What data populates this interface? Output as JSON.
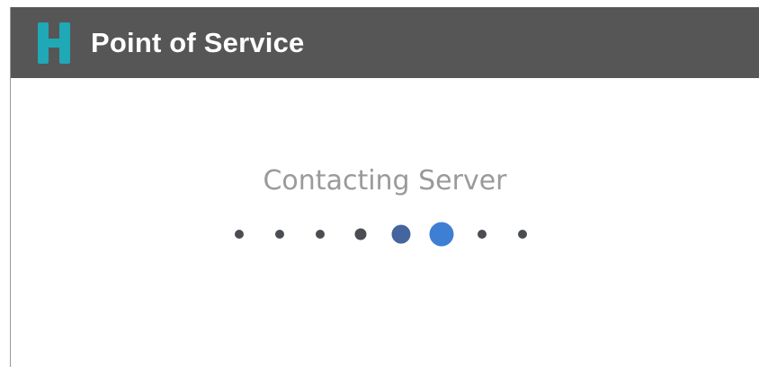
{
  "app": {
    "title": "Point of Service",
    "logo_icon": "h-logo-icon",
    "brand_color": "#1fa8b5",
    "titlebar_color": "#565656"
  },
  "main": {
    "status_text": "Contacting Server",
    "loader": {
      "dot_count": 8,
      "active_index": 5,
      "colors": {
        "idle": "#4a4d52",
        "trail": "#45659e",
        "active": "#3e7fd3"
      }
    }
  }
}
